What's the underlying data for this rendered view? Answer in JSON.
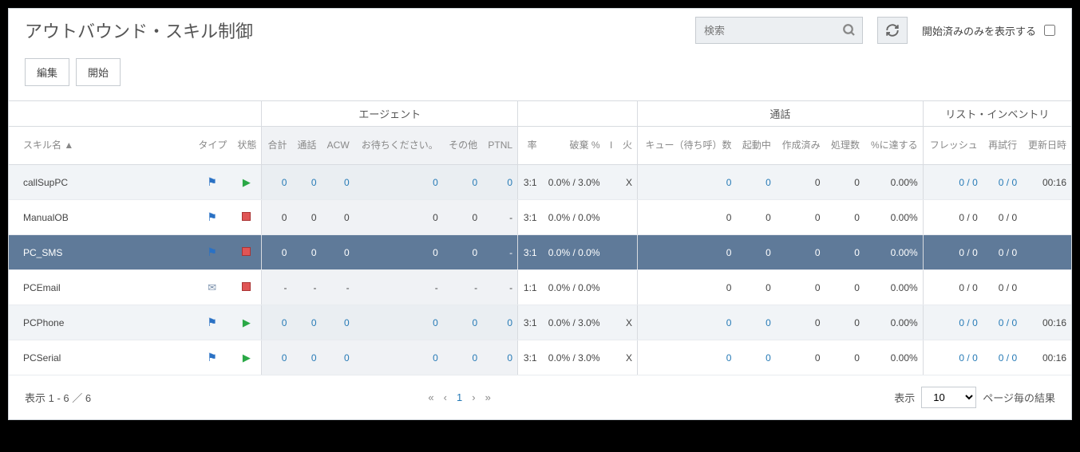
{
  "header": {
    "title": "アウトバウンド・スキル制御",
    "search_placeholder": "検索",
    "started_only_label": "開始済みのみを表示する"
  },
  "toolbar": {
    "edit": "編集",
    "start": "開始"
  },
  "columns": {
    "skill": "スキル名",
    "type": "タイプ",
    "state": "状態",
    "agent_group": "エージェント",
    "total": "合計",
    "talk": "通話",
    "acw": "ACW",
    "wait": "お待ちください。",
    "other": "その他",
    "ptnl": "PTNL",
    "rate": "率",
    "abandon": "破棄 %",
    "i": "I",
    "fire": "火",
    "call_group": "通話",
    "queue": "キュー（待ち呼）数",
    "running": "起動中",
    "created": "作成済み",
    "processed": "処理数",
    "pct_reach": "%に達する",
    "list_group": "リスト・インベントリ",
    "fresh": "フレッシュ",
    "retry": "再試行",
    "updated": "更新日時"
  },
  "rows": [
    {
      "skill": "callSupPC",
      "type": "flag",
      "state": "play",
      "total": "0",
      "talk": "0",
      "acw": "0",
      "wait": "0",
      "other": "0",
      "ptnl": "0",
      "rate": "3:1",
      "abandon": "0.0% / 3.0%",
      "i": "",
      "fire": "X",
      "queue": "0",
      "running": "0",
      "created": "0",
      "processed": "0",
      "pct": "0.00%",
      "fresh": "0 / 0",
      "retry": "0 / 0",
      "updated": "00:16",
      "linkA": true,
      "linkB": true
    },
    {
      "skill": "ManualOB",
      "type": "flag",
      "state": "stop",
      "total": "0",
      "talk": "0",
      "acw": "0",
      "wait": "0",
      "other": "0",
      "ptnl": "-",
      "rate": "3:1",
      "abandon": "0.0% / 0.0%",
      "i": "",
      "fire": "",
      "queue": "0",
      "running": "0",
      "created": "0",
      "processed": "0",
      "pct": "0.00%",
      "fresh": "0 / 0",
      "retry": "0 / 0",
      "updated": "",
      "linkA": false,
      "linkB": false
    },
    {
      "skill": "PC_SMS",
      "type": "flag",
      "state": "stop",
      "total": "0",
      "talk": "0",
      "acw": "0",
      "wait": "0",
      "other": "0",
      "ptnl": "-",
      "rate": "3:1",
      "abandon": "0.0% / 0.0%",
      "i": "",
      "fire": "",
      "queue": "0",
      "running": "0",
      "created": "0",
      "processed": "0",
      "pct": "0.00%",
      "fresh": "0 / 0",
      "retry": "0 / 0",
      "updated": "",
      "linkA": false,
      "linkB": false,
      "selected": true
    },
    {
      "skill": "PCEmail",
      "type": "email",
      "state": "stop",
      "total": "-",
      "talk": "-",
      "acw": "-",
      "wait": "-",
      "other": "-",
      "ptnl": "-",
      "rate": "1:1",
      "abandon": "0.0% / 0.0%",
      "i": "",
      "fire": "",
      "queue": "0",
      "running": "0",
      "created": "0",
      "processed": "0",
      "pct": "0.00%",
      "fresh": "0 / 0",
      "retry": "0 / 0",
      "updated": "",
      "linkA": false,
      "linkB": false
    },
    {
      "skill": "PCPhone",
      "type": "flag",
      "state": "play",
      "total": "0",
      "talk": "0",
      "acw": "0",
      "wait": "0",
      "other": "0",
      "ptnl": "0",
      "rate": "3:1",
      "abandon": "0.0% / 3.0%",
      "i": "",
      "fire": "X",
      "queue": "0",
      "running": "0",
      "created": "0",
      "processed": "0",
      "pct": "0.00%",
      "fresh": "0 / 0",
      "retry": "0 / 0",
      "updated": "00:16",
      "linkA": true,
      "linkB": true
    },
    {
      "skill": "PCSerial",
      "type": "flag",
      "state": "play",
      "total": "0",
      "talk": "0",
      "acw": "0",
      "wait": "0",
      "other": "0",
      "ptnl": "0",
      "rate": "3:1",
      "abandon": "0.0% / 3.0%",
      "i": "",
      "fire": "X",
      "queue": "0",
      "running": "0",
      "created": "0",
      "processed": "0",
      "pct": "0.00%",
      "fresh": "0 / 0",
      "retry": "0 / 0",
      "updated": "00:16",
      "linkA": true,
      "linkB": true
    }
  ],
  "footer": {
    "range": "表示 1 - 6 ／ 6",
    "current_page": "1",
    "show_label": "表示",
    "page_size": "10",
    "per_page_label": "ページ毎の結果"
  }
}
